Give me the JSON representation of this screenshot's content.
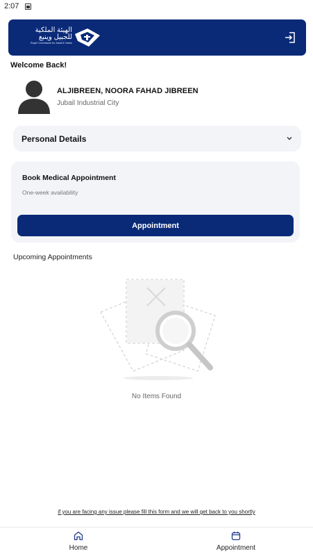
{
  "status_bar": {
    "time": "2:07"
  },
  "header": {
    "logo_arabic": "الهيئة الملكية للجبيل وينبع",
    "logo_english": "Royal Commission for Jubail & Yanbu",
    "logout_icon": "logout-icon",
    "brand_color": "#0a2a78"
  },
  "welcome": "Welcome Back!",
  "user": {
    "name": "ALJIBREEN, NOORA FAHAD JIBREEN",
    "city": "Jubail Industrial City"
  },
  "personal_details": {
    "label": "Personal Details"
  },
  "booking": {
    "title": "Book Medical Appointment",
    "subtitle": "One-week availability",
    "button_label": "Appointment"
  },
  "upcoming": {
    "title": "Upcoming Appointments",
    "empty_text": "No Items Found"
  },
  "issue_link": "if you are facing any issue please fill this form and we will get back to you shortly",
  "bottom_nav": {
    "items": [
      {
        "label": "Home",
        "icon": "home-icon"
      },
      {
        "label": "Appointment",
        "icon": "calendar-icon"
      }
    ]
  }
}
